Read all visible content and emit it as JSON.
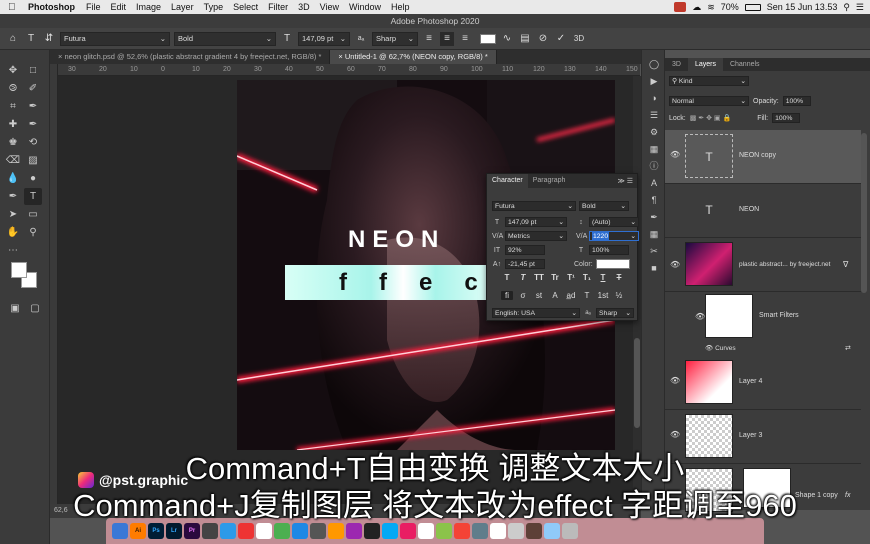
{
  "menubar": {
    "app": "Photoshop",
    "items": [
      "File",
      "Edit",
      "Image",
      "Layer",
      "Type",
      "Select",
      "Filter",
      "3D",
      "View",
      "Window",
      "Help"
    ],
    "battery": "70%",
    "clock": "Sen 15 Jun 13.53"
  },
  "window_title": "Adobe Photoshop 2020",
  "options": {
    "font_family": "Futura",
    "font_style": "Bold",
    "font_size": "147,09 pt",
    "aa_label": "aₐ",
    "antialias": "Sharp"
  },
  "tabs": [
    {
      "label": "neon glitch.psd @ 52,6% (plastic abstract gradient 4 by freeject.net, RGB/8) *"
    },
    {
      "label": "Untitled-1 @ 62,7% (NEON copy, RGB/8) *"
    }
  ],
  "ruler": {
    "ticks": [
      "30",
      "20",
      "10",
      "0",
      "10",
      "20",
      "30",
      "40",
      "50",
      "60",
      "70",
      "80",
      "90",
      "100",
      "110",
      "120",
      "130",
      "140",
      "150"
    ]
  },
  "canvas": {
    "title_text": "NEON",
    "effect_text": "ffec"
  },
  "character_panel": {
    "tabs": [
      "Character",
      "Paragraph"
    ],
    "font_family": "Futura",
    "font_style": "Bold",
    "size": "147,09 pt",
    "leading": "(Auto)",
    "kerning": "Metrics",
    "tracking": "1220",
    "vscale": "92%",
    "hscale": "100%",
    "baseline": "-21,45 pt",
    "color_label": "Color:",
    "language": "English: USA",
    "aa": "Sharp",
    "aa_label": "aₐ",
    "glyph_row1": [
      "T",
      "T",
      "TT",
      "Tr",
      "T¹",
      "T₁",
      "T",
      "T"
    ],
    "glyph_row2": [
      "fi",
      "σ",
      "st",
      "A",
      "a̲d",
      "T",
      "1st",
      "½"
    ]
  },
  "layers_panel": {
    "tabs": [
      "3D",
      "Layers",
      "Channels"
    ],
    "kind_placeholder": "Kind",
    "blend_mode": "Normal",
    "opacity_label": "Opacity:",
    "opacity": "100%",
    "lock_label": "Lock:",
    "fill_label": "Fill:",
    "fill": "100%",
    "layers": [
      {
        "name": "NEON copy",
        "type": "text"
      },
      {
        "name": "NEON",
        "type": "text"
      },
      {
        "name": "plastic abstract... by freeject.net",
        "type": "smart"
      },
      {
        "name": "Smart Filters",
        "type": "filter"
      },
      {
        "name": "Curves",
        "type": "curves"
      },
      {
        "name": "Layer 4",
        "type": "pixel"
      },
      {
        "name": "Layer 3",
        "type": "pixel"
      },
      {
        "name": "Shape 1 copy",
        "type": "shape"
      }
    ],
    "fx_label": "fx"
  },
  "status": {
    "zoom": "62,6"
  },
  "watermark": "@pst.graphic",
  "subtitles": {
    "line1": "Command+T自由变换 调整文本大小",
    "line2": "Command+J复制图层 将文本改为effect 字距调至960"
  },
  "dock": [
    "",
    "Ai",
    "Ps",
    "Lr",
    "Pr",
    "",
    ""
  ],
  "colors": {
    "accent": "#2f6fd1",
    "neon_red": "#ff1a3c",
    "effect_band": "#a8f4ea"
  }
}
